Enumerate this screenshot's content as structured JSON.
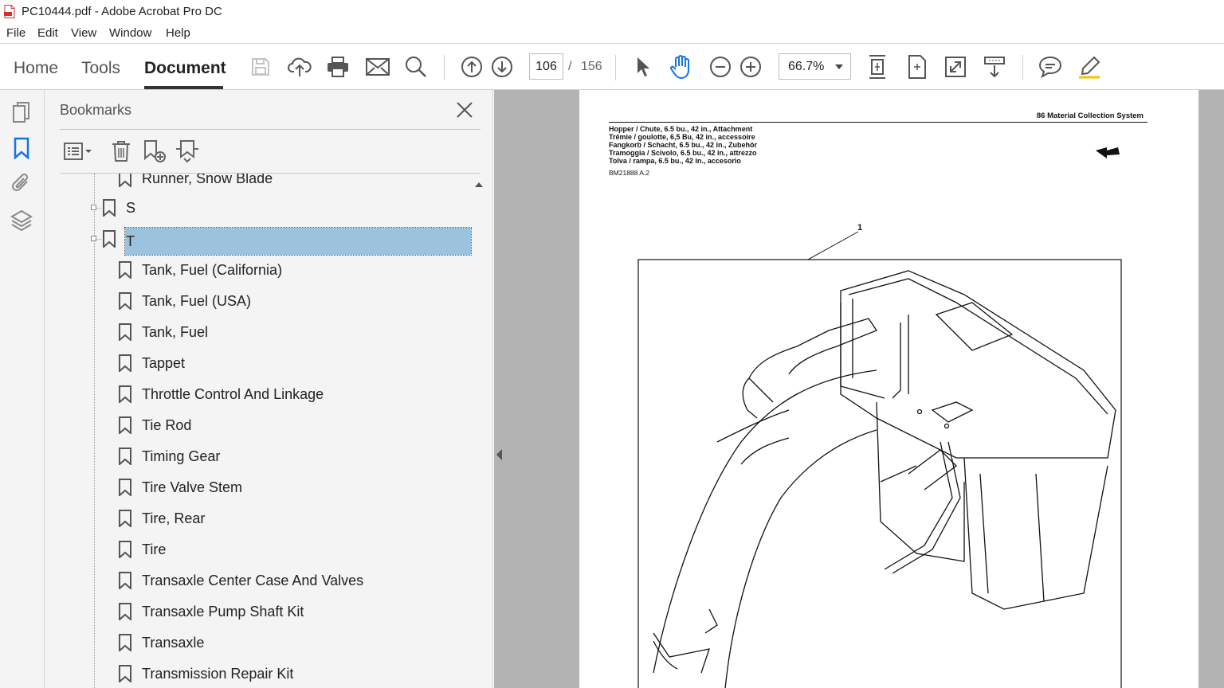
{
  "window": {
    "title": "PC10444.pdf - Adobe Acrobat Pro DC"
  },
  "menu": [
    "File",
    "Edit",
    "View",
    "Window",
    "Help"
  ],
  "toolbar": {
    "tabs": [
      "Home",
      "Tools",
      "Document"
    ],
    "active_tab": "Document",
    "current_page": "106",
    "page_separator": "/",
    "total_pages": "156",
    "zoom": "66.7%"
  },
  "bookmarks": {
    "title": "Bookmarks",
    "items": [
      {
        "label": "Runner, Snow Blade",
        "level": 2
      },
      {
        "label": "S",
        "level": 1
      },
      {
        "label": "T",
        "level": 1,
        "selected": true
      },
      {
        "label": "Tank, Fuel (California)",
        "level": 2
      },
      {
        "label": "Tank, Fuel (USA)",
        "level": 2
      },
      {
        "label": "Tank, Fuel",
        "level": 2
      },
      {
        "label": "Tappet",
        "level": 2
      },
      {
        "label": "Throttle Control And Linkage",
        "level": 2
      },
      {
        "label": "Tie Rod",
        "level": 2
      },
      {
        "label": "Timing Gear",
        "level": 2
      },
      {
        "label": "Tire Valve Stem",
        "level": 2
      },
      {
        "label": "Tire, Rear",
        "level": 2
      },
      {
        "label": "Tire",
        "level": 2
      },
      {
        "label": "Transaxle Center Case And Valves",
        "level": 2
      },
      {
        "label": "Transaxle Pump Shaft Kit",
        "level": 2
      },
      {
        "label": "Transaxle",
        "level": 2
      },
      {
        "label": "Transmission Repair Kit",
        "level": 2
      }
    ]
  },
  "document_page": {
    "section_header": "86 Material Collection System",
    "title_lines": [
      "Hopper / Chute, 6.5 bu., 42 in., Attachment",
      "Trémie / goulotte, 6,5 Bu, 42 in., accessoire",
      "Fangkorb / Schacht, 6.5 bu., 42 in., Zubehör",
      "Tramoggia / Scivolo, 6.5 bu., 42 in., attrezzo",
      "Tolva / rampa, 6.5 bu., 42 in., accesorio"
    ],
    "figure_code": "BM21888 A.2",
    "callout": "1"
  },
  "colors": {
    "selection": "#9cc3dd",
    "accent_blue": "#1473e6",
    "doc_background": "#b3b3b3"
  }
}
